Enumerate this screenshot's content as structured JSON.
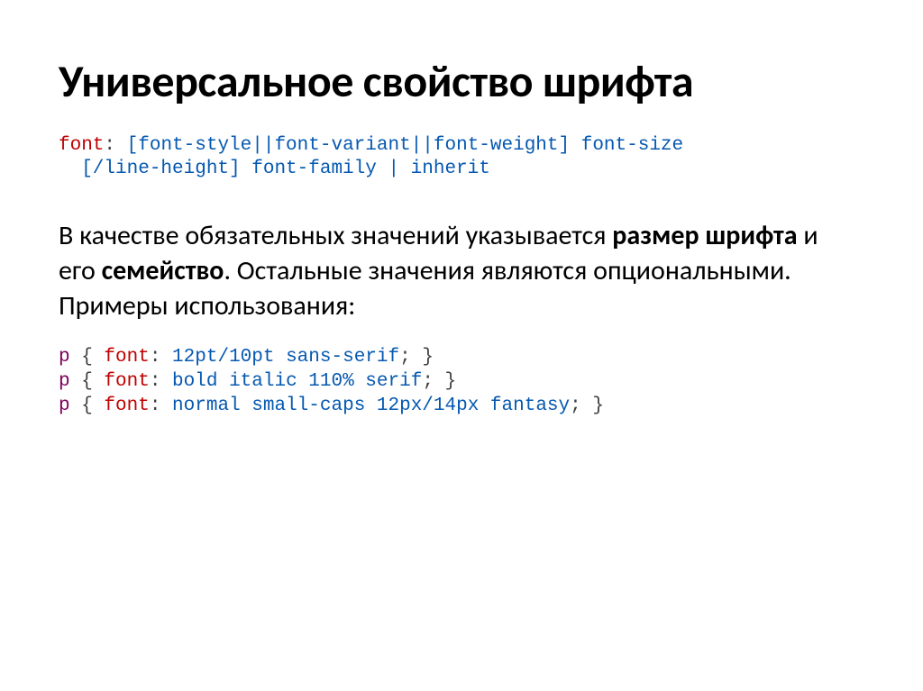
{
  "title": "Универсальное свойство шрифта",
  "syntax": {
    "prop": "font",
    "colon": ":",
    "line1_rest": " [font-style||font-variant||font-weight] font-size",
    "line2_rest": "  [/line-height] font-family | inherit"
  },
  "para": {
    "t1": "В качестве обязательных значений указывается ",
    "b1": "размер шрифта",
    "t2": " и его ",
    "b2": "семейство",
    "t3": ". Остальные значения являются опциональными. Примеры использования:"
  },
  "examples": [
    {
      "sel": "p",
      "prop": "font",
      "val": " 12pt/10pt sans-serif"
    },
    {
      "sel": "p",
      "prop": "font",
      "val": " bold italic 110% serif"
    },
    {
      "sel": "p",
      "prop": "font",
      "val": " normal small-caps 12px/14px fantasy"
    }
  ],
  "punct": {
    "lbrace": " { ",
    "rbrace": "; }",
    "colon": ":"
  }
}
